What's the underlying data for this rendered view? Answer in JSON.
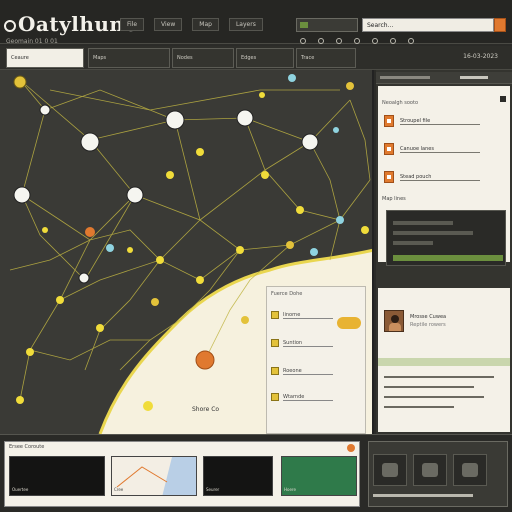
{
  "app": {
    "title": "Oatylhune",
    "subtitle": "Geomain 01 0 01",
    "search_placeholder": "Search..."
  },
  "header": {
    "nav": [
      "File",
      "View",
      "Map",
      "Layers"
    ],
    "control_label": "Layers"
  },
  "tabs": [
    "Ceaure",
    "Maps",
    "Nodes",
    "Edges",
    "Trace"
  ],
  "tab_date": "16-03-2023",
  "map": {
    "place_label": "Shore Co",
    "colors": {
      "land_dark": "#3a3a36",
      "land_light": "#f6f1de",
      "route": "#d9c84a",
      "node_white": "#f5f5f0",
      "node_yellow": "#f0dc3a",
      "node_orange": "#e0792f"
    }
  },
  "right_panel": {
    "card_title": "Neoalgh sooto",
    "items": [
      {
        "label": "Stroupel file"
      },
      {
        "label": "Canuoe lanes"
      },
      {
        "label": "Stead pouch"
      }
    ],
    "file_label": "Map lines",
    "profile": {
      "name": "Mrosse Cuwea",
      "meta": "Reptile rowers"
    }
  },
  "popup": {
    "title": "Fuerce Dohe",
    "items": [
      {
        "label": "Iinorne"
      },
      {
        "label": "Suntion"
      },
      {
        "label": "Roeone"
      },
      {
        "label": "Wtarnde"
      }
    ]
  },
  "bottom": {
    "card_title": "Ersee Coroute",
    "thumbs": [
      {
        "caption": "Ouertee",
        "kind": "dark"
      },
      {
        "caption": "Cree",
        "kind": "map"
      },
      {
        "caption": "Seurer",
        "kind": "dark"
      },
      {
        "caption": "Hoere",
        "kind": "green"
      }
    ]
  }
}
